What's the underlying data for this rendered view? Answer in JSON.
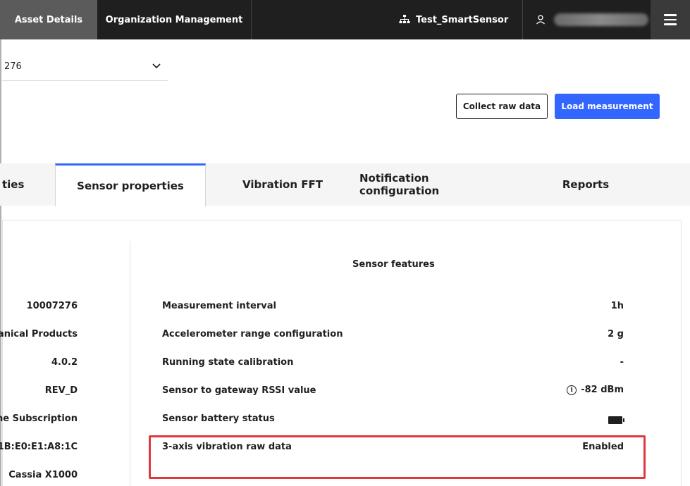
{
  "topnav": {
    "tabs": [
      {
        "label": "Asset Details",
        "active": true
      },
      {
        "label": "Organization Management",
        "active": false
      }
    ],
    "org_name": "Test_SmartSensor",
    "org_icon": "hierarchy-icon",
    "user_icon": "user-icon",
    "menu_icon": "hamburger-menu-icon"
  },
  "asset_selector": {
    "value": "276",
    "chevron": "⌄"
  },
  "actions": {
    "collect_raw_label": "Collect raw data",
    "load_measurement_label": "Load measurement"
  },
  "tabs": [
    {
      "label": "ties",
      "active": false
    },
    {
      "label": "Sensor properties",
      "active": true
    },
    {
      "label": "Vibration FFT",
      "active": false
    },
    {
      "label": "Notification configuration",
      "active": false
    },
    {
      "label": "Reports",
      "active": false
    }
  ],
  "left_values": [
    "10007276",
    "anical Products",
    "4.0.2",
    "REV_D",
    "ne Subscription",
    ":1B:E0:E1:A8:1C",
    "Cassia X1000"
  ],
  "sensor_features": {
    "title": "Sensor features",
    "rows": [
      {
        "label": "Measurement interval",
        "value": "1h"
      },
      {
        "label": "Accelerometer range configuration",
        "value": "2 g"
      },
      {
        "label": "Running state calibration",
        "value": "-"
      },
      {
        "label": "Sensor to gateway RSSI value",
        "value": "-82 dBm",
        "icon": "info-icon"
      },
      {
        "label": "Sensor battery status",
        "value": "",
        "icon": "battery-full-icon"
      },
      {
        "label": "3-axis vibration raw data",
        "value": "Enabled"
      }
    ]
  },
  "colors": {
    "accent": "#3366ff",
    "topbar": "#1f1f1f",
    "highlight": "#e0393e"
  }
}
